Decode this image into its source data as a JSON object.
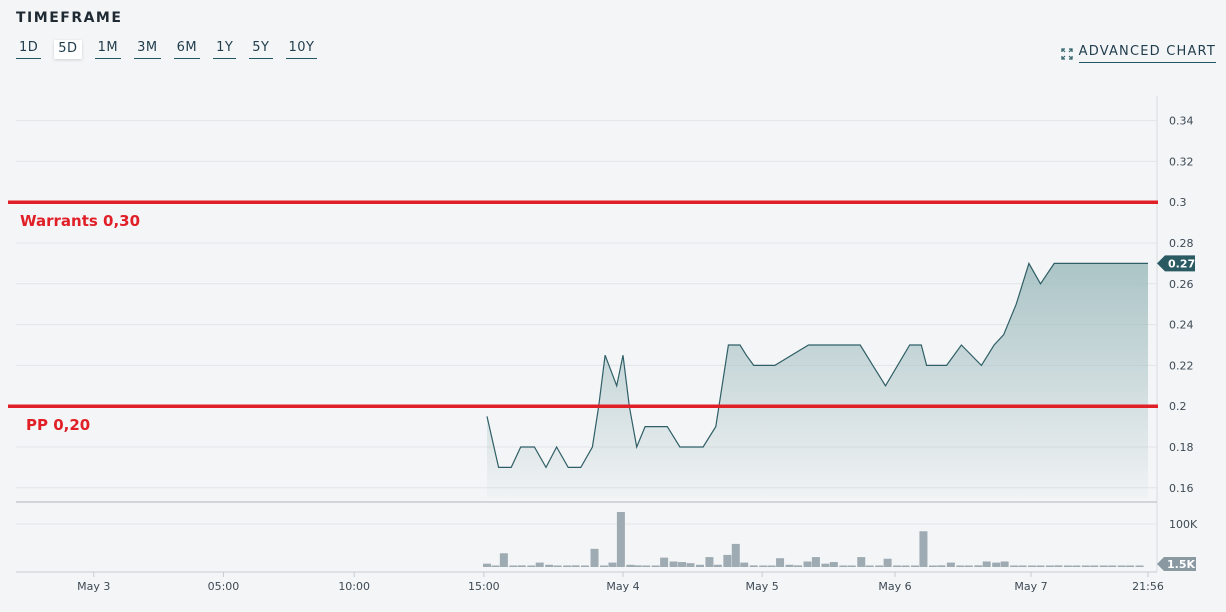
{
  "header": {
    "title": "TIMEFRAME",
    "timeframes": [
      "1D",
      "5D",
      "1M",
      "3M",
      "6M",
      "1Y",
      "5Y",
      "10Y"
    ],
    "active": "5D",
    "advanced_label": "ADVANCED CHART"
  },
  "colors": {
    "line": "#2f5f66",
    "area": "#9fbcbe",
    "grid": "#e2e5e8",
    "volume": "#9eabb3",
    "annotation": "#e01f26",
    "price_tag": "#2a5a62"
  },
  "chart_data": {
    "type": "line",
    "x_ticks": [
      "May 3",
      "05:00",
      "10:00",
      "15:00",
      "May 4",
      "May 5",
      "May 6",
      "May 7",
      "21:56"
    ],
    "y_ticks": [
      "0.34",
      "0.32",
      "0.3",
      "0.28",
      "0.26",
      "0.24",
      "0.22",
      "0.2",
      "0.18",
      "0.16"
    ],
    "ylim": [
      0.155,
      0.355
    ],
    "x_range": [
      0,
      100
    ],
    "x_tick_positions": [
      0,
      12.3,
      24.7,
      37.0,
      50.2,
      63.4,
      76.0,
      88.9,
      100
    ],
    "price": {
      "x": [
        37.3,
        38.4,
        39.6,
        40.5,
        41.8,
        42.9,
        43.9,
        45.0,
        46.2,
        47.3,
        47.9,
        48.5,
        49.6,
        50.2,
        50.8,
        51.5,
        52.3,
        53.2,
        54.4,
        55.6,
        56.7,
        57.8,
        59.0,
        60.2,
        61.3,
        61.9,
        62.6,
        63.4,
        64.6,
        67.8,
        68.9,
        72.7,
        73.9,
        75.1,
        77.4,
        78.5,
        79.0,
        80.9,
        82.3,
        84.2,
        85.4,
        86.3,
        87.5,
        88.7,
        89.8,
        91.1,
        92.6,
        93.7,
        94.9,
        95.5,
        100
      ],
      "values": [
        0.195,
        0.17,
        0.17,
        0.18,
        0.18,
        0.17,
        0.18,
        0.17,
        0.17,
        0.18,
        0.2,
        0.225,
        0.21,
        0.225,
        0.2,
        0.18,
        0.19,
        0.19,
        0.19,
        0.18,
        0.18,
        0.18,
        0.19,
        0.23,
        0.23,
        0.225,
        0.22,
        0.22,
        0.22,
        0.23,
        0.23,
        0.23,
        0.22,
        0.21,
        0.23,
        0.23,
        0.22,
        0.22,
        0.23,
        0.22,
        0.23,
        0.235,
        0.25,
        0.27,
        0.26,
        0.27,
        0.27,
        0.27,
        0.27,
        0.27,
        0.27
      ],
      "last_label": "0.27"
    },
    "volume": {
      "ylabel_top": "100K",
      "last_label": "1.5K",
      "max": 100,
      "x": [
        37.3,
        38.1,
        38.9,
        39.8,
        40.6,
        41.5,
        42.3,
        43.2,
        44.0,
        44.9,
        45.7,
        46.6,
        47.5,
        48.4,
        49.2,
        50.0,
        50.9,
        51.6,
        52.4,
        53.3,
        54.1,
        55.0,
        55.8,
        56.6,
        57.5,
        58.4,
        59.2,
        60.1,
        60.9,
        61.7,
        62.6,
        63.5,
        64.3,
        65.1,
        66.0,
        66.8,
        67.7,
        68.5,
        69.4,
        70.2,
        71.1,
        71.9,
        72.8,
        73.6,
        74.5,
        75.3,
        76.2,
        77.0,
        77.9,
        78.7,
        79.6,
        80.4,
        81.3,
        82.2,
        83.0,
        83.9,
        84.7,
        85.6,
        86.4,
        87.3,
        88.1,
        89.0,
        89.8,
        90.7,
        91.5,
        92.4,
        93.2,
        94.1,
        94.9,
        95.8,
        96.6,
        97.5,
        98.3,
        99.2
      ],
      "values": [
        6,
        2,
        25,
        2,
        3,
        2,
        8,
        4,
        2,
        2,
        3,
        2,
        33,
        2,
        8,
        100,
        4,
        3,
        2,
        2,
        17,
        10,
        9,
        7,
        4,
        18,
        4,
        22,
        42,
        8,
        3,
        2,
        2,
        16,
        4,
        3,
        10,
        18,
        6,
        9,
        2,
        2,
        18,
        2,
        2,
        15,
        2,
        2,
        2,
        65,
        2,
        3,
        8,
        2,
        2,
        3,
        10,
        8,
        10,
        2,
        2,
        2,
        2,
        2,
        3,
        2,
        2,
        2,
        2,
        2,
        2,
        2,
        2,
        2
      ]
    },
    "annotations": [
      {
        "label": "Warrants 0,30",
        "value": 0.3
      },
      {
        "label": "PP 0,20",
        "value": 0.2
      }
    ]
  }
}
